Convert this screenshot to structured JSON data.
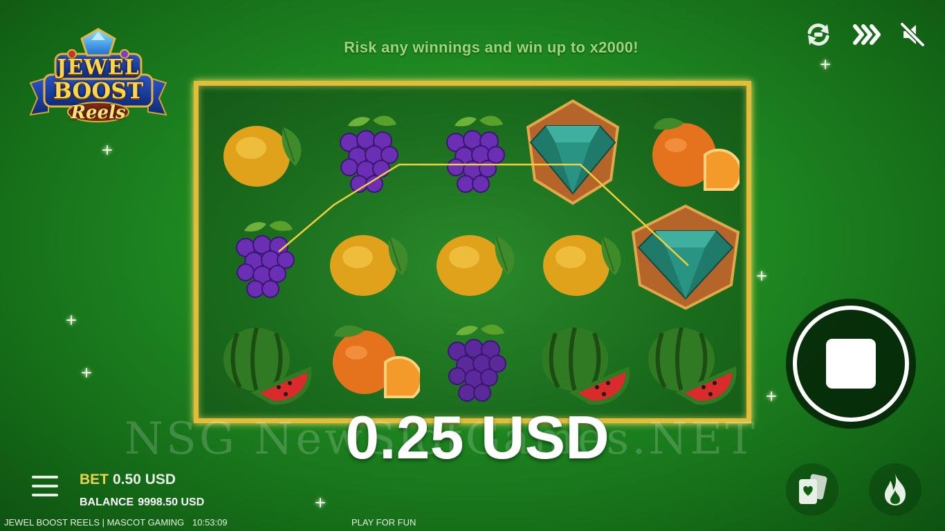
{
  "header": {
    "message": "Risk any winnings and win up to x2000!"
  },
  "logo": {
    "line1": "JEWEL",
    "line2": "BOOST",
    "line3": "Reels"
  },
  "top_controls": {
    "icons": [
      "autoplay-refresh-icon",
      "turbo-icon",
      "sound-muted-icon"
    ]
  },
  "reels": {
    "rows": [
      [
        "lemon",
        "grapes",
        "grapes",
        "diamond",
        "orange"
      ],
      [
        "grapes",
        "lemon",
        "lemon",
        "lemon",
        "diamond"
      ],
      [
        "watermelon",
        "orange",
        "grapes",
        "watermelon",
        "watermelon"
      ]
    ],
    "payline_color": "#f2d03c",
    "frame_color": "#e2bd3a"
  },
  "win": {
    "amount": "0.25 USD"
  },
  "watermark": {
    "text": "NSG NewSlotGames.NET"
  },
  "bottom_bar": {
    "bet_label": "BET",
    "bet_value": "0.50 USD",
    "balance_label": "BALANCE",
    "balance_value": "9998.50 USD",
    "game_info": "JEWEL BOOST REELS | MASCOT GAMING",
    "time": "10:53:09",
    "mode": "PLAY FOR FUN"
  },
  "colors": {
    "background": "#1f8a22",
    "bet_label": "#e8d44a",
    "message": "#9ed67e"
  }
}
